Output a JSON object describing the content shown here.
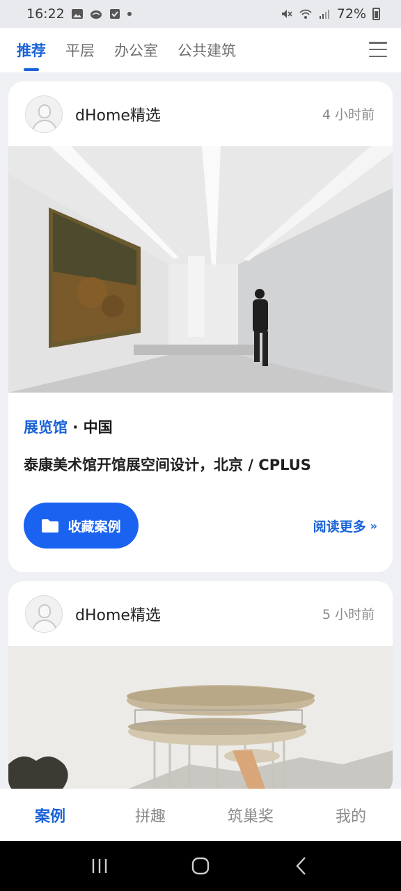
{
  "status_bar": {
    "time": "16:22",
    "battery": "72%"
  },
  "top_tabs": [
    {
      "label": "推荐",
      "active": true
    },
    {
      "label": "平层",
      "active": false
    },
    {
      "label": "办公室",
      "active": false
    },
    {
      "label": "公共建筑",
      "active": false
    }
  ],
  "cards": [
    {
      "author": "dHome精选",
      "time": "4 小时前",
      "category_type": "展览馆",
      "category_sep": " · ",
      "location": "中国",
      "title": "泰康美术馆开馆展空间设计，北京 / CPLUS",
      "save_label": "收藏案例",
      "read_more": "阅读更多",
      "read_more_chevron": "»"
    },
    {
      "author": "dHome精选",
      "time": "5 小时前"
    }
  ],
  "bottom_nav": [
    {
      "label": "案例",
      "active": true
    },
    {
      "label": "拼趣",
      "active": false
    },
    {
      "label": "筑巢奖",
      "active": false
    },
    {
      "label": "我的",
      "active": false
    }
  ],
  "colors": {
    "accent": "#1a63d8",
    "button": "#1a63f0"
  }
}
